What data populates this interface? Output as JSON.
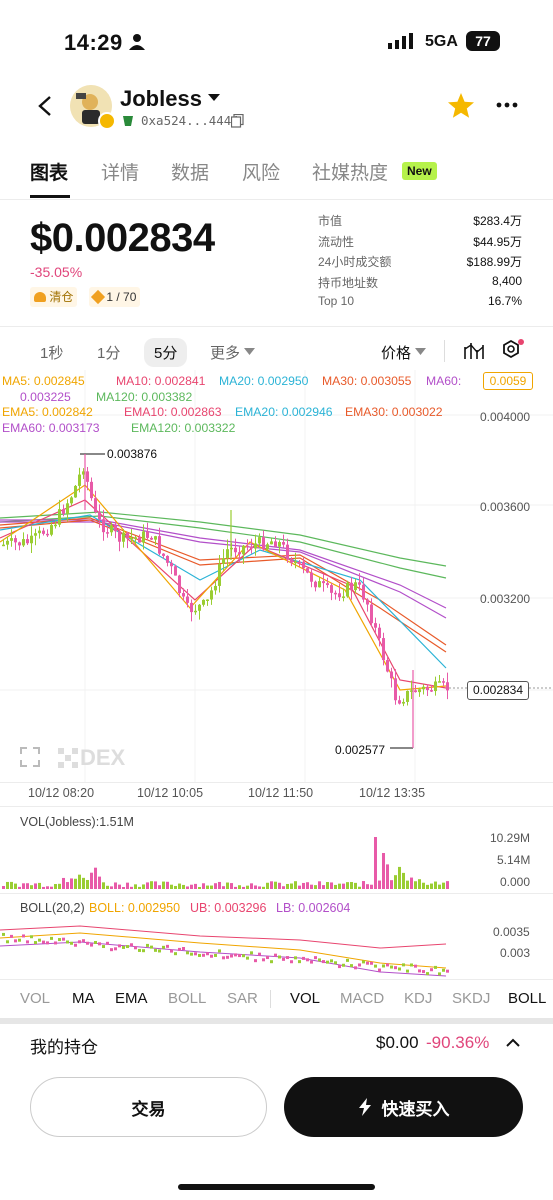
{
  "status_bar": {
    "time": "14:29",
    "network": "5GA",
    "battery": "77"
  },
  "header": {
    "title": "Jobless",
    "address": "0xa524...4444"
  },
  "tabs": [
    {
      "label": "图表",
      "active": true
    },
    {
      "label": "详情"
    },
    {
      "label": "数据"
    },
    {
      "label": "风险"
    },
    {
      "label": "社媒热度"
    }
  ],
  "tab_badge": "New",
  "price": {
    "value": "$0.002834",
    "change": "-35.05%",
    "tag1": "清仓",
    "tag2": "1 / 70"
  },
  "stats": [
    {
      "label": "市值",
      "value": "$283.4万"
    },
    {
      "label": "流动性",
      "value": "$44.95万"
    },
    {
      "label": "24小时成交额",
      "value": "$188.99万"
    },
    {
      "label": "持币地址数",
      "value": "8,400"
    },
    {
      "label": "Top 10",
      "value": "16.7%"
    }
  ],
  "timeframes": [
    "1秒",
    "1分",
    "5分",
    "更多"
  ],
  "price_selector": "价格",
  "ma_lines": {
    "ma5": "MA5: 0.002845",
    "ma10": "MA10: 0.002841",
    "ma20": "MA20: 0.002950",
    "ma30": "MA30: 0.003055",
    "ma60": "MA60:",
    "ma60_val": "0.003225",
    "ma120": "MA120: 0.003382",
    "ema5": "EMA5: 0.002842",
    "ema10": "EMA10: 0.002863",
    "ema20": "EMA20: 0.002946",
    "ema30": "EMA30: 0.003022",
    "ema60": "EMA60: 0.003173",
    "ema120": "EMA120: 0.003322"
  },
  "price_axis": [
    "0.0059",
    "0.004000",
    "0.003600",
    "0.003200",
    "0.002834"
  ],
  "annotations": {
    "high": "0.003876",
    "low": "0.002577"
  },
  "watermark": "DEX",
  "time_axis": [
    "10/12 08:20",
    "10/12 10:05",
    "10/12 11:50",
    "10/12 13:35"
  ],
  "volume": {
    "label": "VOL(Jobless):1.51M",
    "axis": [
      "10.29M",
      "5.14M",
      "0.000"
    ]
  },
  "boll": {
    "label": "BOLL(20,2)",
    "boll": "BOLL: 0.002950",
    "ub": "UB: 0.003296",
    "lb": "LB: 0.002604",
    "axis": [
      "0.0035",
      "0.003"
    ]
  },
  "indicator_tabs": [
    "VOL",
    "MA",
    "EMA",
    "BOLL",
    "SAR",
    "VOL",
    "MACD",
    "KDJ",
    "SKDJ",
    "BOLL"
  ],
  "holdings": {
    "label": "我的持仓",
    "value": "$0.00",
    "change": "-90.36%"
  },
  "buttons": {
    "trade": "交易",
    "quick_buy": "快速买入"
  },
  "colors": {
    "up": "#9acd32",
    "down": "#e85aa8",
    "accent_green": "#b6f24b",
    "negative": "#e0457b",
    "star": "#f5b800"
  }
}
